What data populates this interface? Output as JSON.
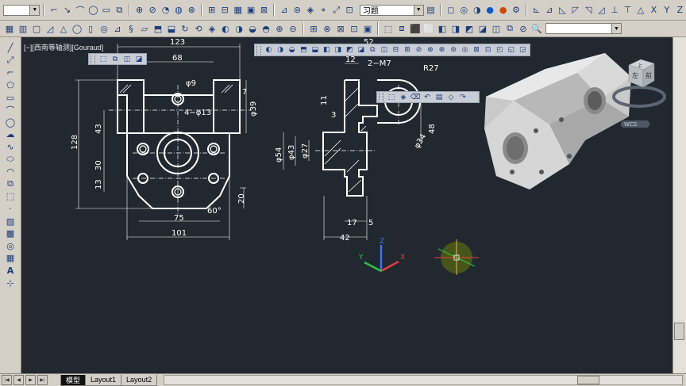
{
  "toolbar_top": {
    "combo_style": "",
    "combo_visual_style": "习题",
    "combo_right": ""
  },
  "toolbar_second": {
    "combo_layer": ""
  },
  "viewport": {
    "label": "[−][西南等轴测][Gouraud]",
    "background": "#212830"
  },
  "viewcube": {
    "top_face": "上",
    "left_face": "左",
    "front_face": "前",
    "wcs_label": "WCS"
  },
  "drawing": {
    "front_view_dims": {
      "d123": "123",
      "d68": "68",
      "phi9": "φ9",
      "hole4": "4−φ13",
      "d7": "7",
      "phi39": "φ39",
      "d43": "43",
      "d128": "128",
      "d30": "30",
      "d13": "13",
      "d20": "20",
      "ang60": "60°",
      "d75": "75",
      "d101": "101"
    },
    "side_view_dims": {
      "d52": "52",
      "d12": "12",
      "thread": "2−M7",
      "r27": "R27",
      "d11": "11",
      "d3": "3",
      "phi34": "φ34",
      "d48": "48",
      "phi54": "φ54",
      "phi43": "φ43",
      "phi27": "φ27",
      "d17": "17",
      "d5": "5",
      "d42": "42"
    }
  },
  "ucs_icon": {
    "x": "X",
    "y": "Y",
    "z": "Z"
  },
  "layout_tabs": {
    "model": "模型",
    "layout1": "Layout1",
    "layout2": "Layout2"
  },
  "colors": {
    "toolbar_bg": "#d4d0c8",
    "viewport_bg": "#212830",
    "drawing_lines": "#ffffff",
    "axis_x": "#e04040",
    "axis_y": "#30c040",
    "axis_z": "#4070ff"
  },
  "icons": {
    "top_row": [
      "line-icon",
      "polyline-icon",
      "arc-icon",
      "circle-icon",
      "rectangle-icon",
      "offset-icon",
      "move-icon",
      "copy-icon",
      "rotate-icon",
      "scale-icon",
      "stretch-icon",
      "trim-icon",
      "extend-icon",
      "fillet-icon",
      "chamfer-icon",
      "explode-icon",
      "mirror-icon",
      "array-icon",
      "erase-icon",
      "hatch-icon",
      "dimension-icon",
      "text-icon"
    ],
    "left_column": [
      "line-icon",
      "construction-line-icon",
      "polyline-icon",
      "polygon-icon",
      "rectangle-icon",
      "arc-icon",
      "circle-icon",
      "revision-cloud-icon",
      "spline-icon",
      "ellipse-icon",
      "ellipse-arc-icon",
      "insert-block-icon",
      "make-block-icon",
      "point-icon",
      "hatch-icon",
      "gradient-icon",
      "region-icon",
      "table-icon",
      "multiline-text-icon",
      "add-selected-icon"
    ]
  }
}
